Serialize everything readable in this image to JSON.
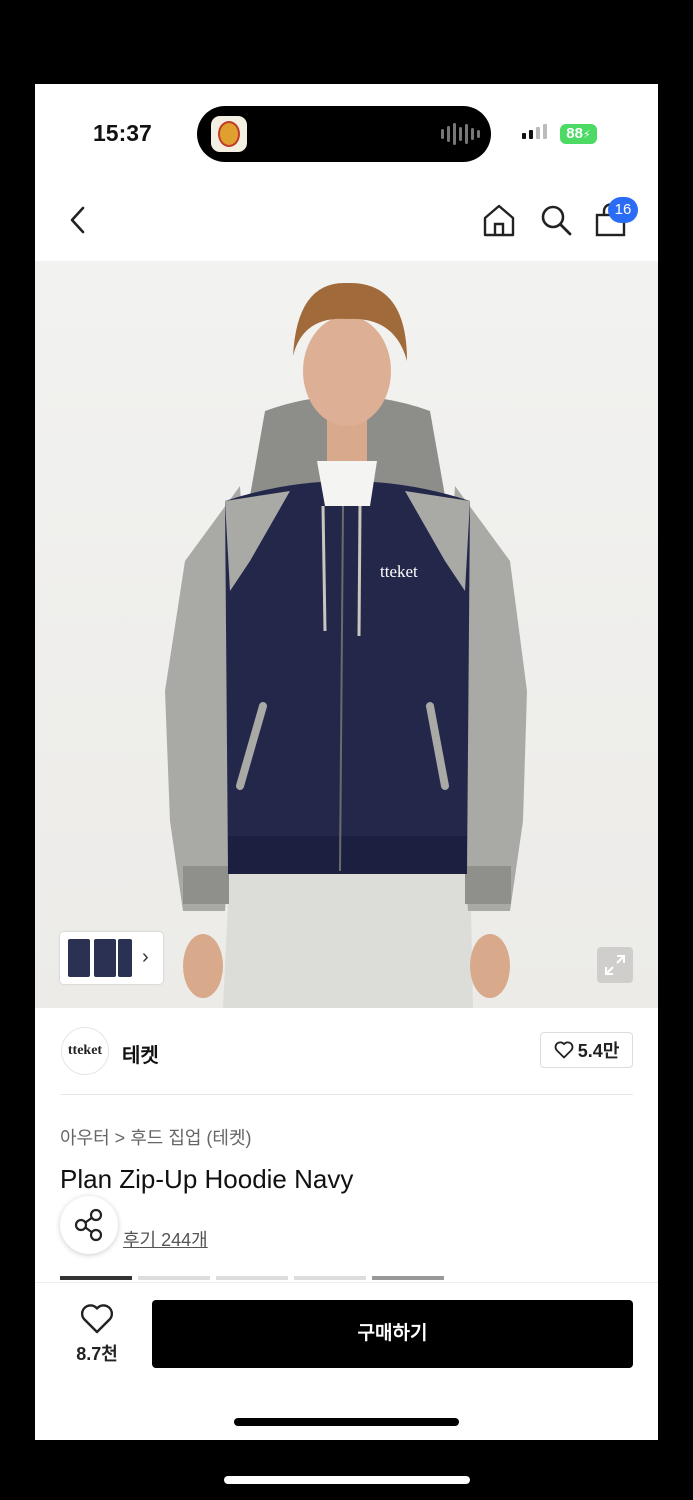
{
  "status_bar": {
    "time": "15:37",
    "battery": "88"
  },
  "header": {
    "back_icon": "chevron-left-icon",
    "home_icon": "home-icon",
    "search_icon": "search-icon",
    "cart_icon": "shopping-bag-icon",
    "cart_badge": "16"
  },
  "hero": {
    "logo_text": "tteket"
  },
  "brand": {
    "logo_text": "tteket",
    "name": "테켓",
    "likes": "5.4만"
  },
  "product": {
    "breadcrumb": "아우터 > 후드 집업 (테켓)",
    "title": "Plan Zip-Up Hoodie Navy",
    "review_link": "후기 244개"
  },
  "bottom_bar": {
    "wish_count": "8.7천",
    "buy_label": "구매하기"
  },
  "colors": {
    "accent": "#2b6cf6",
    "battery": "#4cd964",
    "buy_button": "#000000"
  }
}
